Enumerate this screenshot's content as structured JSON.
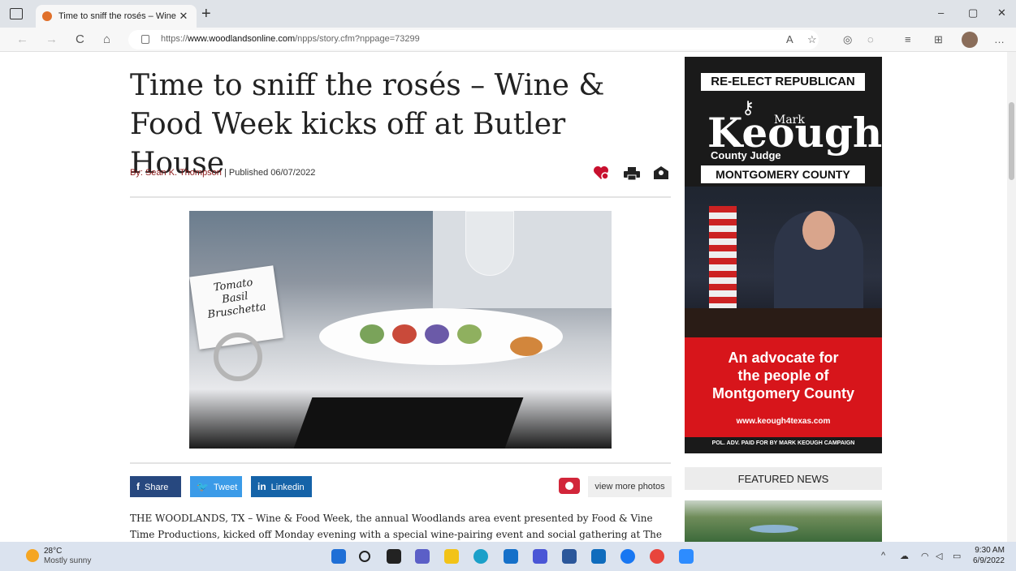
{
  "browser": {
    "tab_title": "Time to sniff the rosés – Wine &",
    "tab_close": "✕",
    "new_tab": "+",
    "url_prefix": "https://",
    "url_domain": "www.woodlandsonline.com",
    "url_path": "/npps/story.cfm?nppage=73299",
    "window_controls": [
      "–",
      "▢",
      "✕"
    ],
    "nav": {
      "back": "←",
      "forward": "→",
      "reload": "C",
      "home": "⌂"
    }
  },
  "article": {
    "headline": "Time to sniff the rosés – Wine & Food Week kicks off at Butler House",
    "byline_prefix": "By: ",
    "author": "Sean K. Thompson",
    "published": " | Published 06/07/2022",
    "photo_card_text": "Tomato\nBasil\nBruschetta",
    "share_facebook": "Share",
    "share_twitter": "Tweet",
    "share_linkedin": "Linkedin",
    "share_facebook_icon": "f",
    "share_twitter_icon": "🐦",
    "share_linkedin_icon": "in",
    "view_more_photos": "view more photos",
    "body": "THE WOODLANDS, TX – Wine & Food Week, the annual Woodlands area event presented by Food & Vine Time Productions, kicked off Monday evening with a special wine-pairing event and social gathering at The Butler"
  },
  "ad": {
    "line1": "RE-ELECT REPUBLICAN",
    "mark": "Mark",
    "name": "Keough",
    "office": "County Judge",
    "county": "MONTGOMERY COUNTY",
    "slogan": "An advocate for\nthe people of\nMontgomery County",
    "website": "www.keough4texas.com",
    "disclaimer": "POL. ADV. PAID FOR BY MARK KEOUGH CAMPAIGN"
  },
  "sidebar": {
    "featured_title": "FEATURED NEWS"
  },
  "taskbar": {
    "temperature": "28°C",
    "condition": "Mostly sunny",
    "time": "9:30 AM",
    "date": "6/9/2022"
  }
}
